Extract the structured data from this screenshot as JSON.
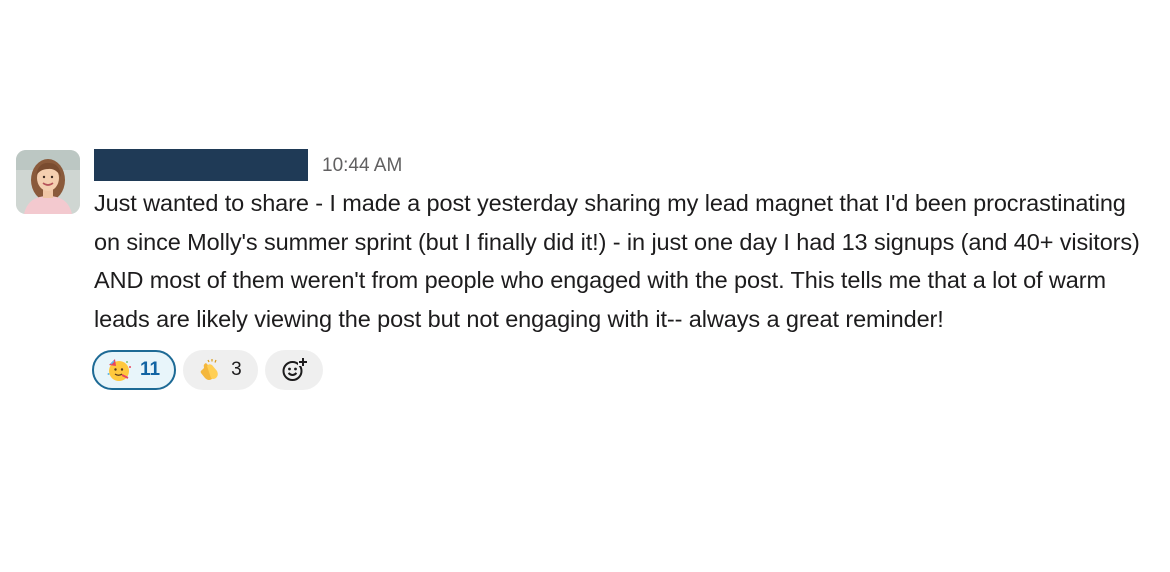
{
  "message": {
    "author": "",
    "timestamp": "10:44 AM",
    "text": "Just wanted to share - I made a post yesterday sharing my lead magnet that I'd been procrastinating on since Molly's summer sprint (but I finally did it!) - in just one day I had 13 signups (and 40+ visitors) AND most of them weren't from people who engaged with the post. This tells me that a lot of warm leads are likely viewing the post but not engaging with it-- always a great reminder!"
  },
  "reactions": [
    {
      "emoji": "partying-face-icon",
      "count": "11",
      "active": true
    },
    {
      "emoji": "clapping-hands-icon",
      "count": "3",
      "active": false
    }
  ],
  "colors": {
    "redaction": "#1f3a56",
    "active_reaction_border": "#1d6a95",
    "active_reaction_bg": "#e8f5fa",
    "inactive_reaction_bg": "#efefef"
  }
}
